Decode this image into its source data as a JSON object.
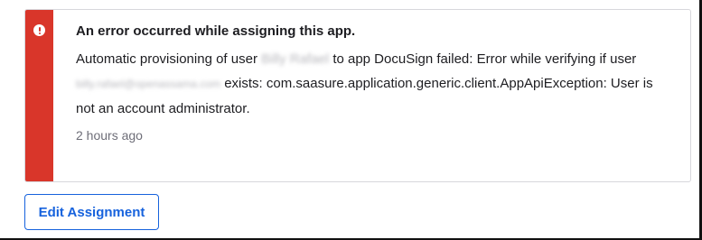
{
  "alert": {
    "severity": "error",
    "colors": {
      "accent_bar": "#d9362a",
      "border": "#d7d7dc",
      "text": "#1d1d21",
      "muted_text": "#6e6e78"
    },
    "icon": "error-circle-icon",
    "title": "An error occurred while assigning this app.",
    "message": {
      "part1": "Automatic provisioning of user",
      "user_name_redacted": "Billy Rafael",
      "part2": "to app DocuSign failed: Error while verifying if user",
      "user_email_redacted": "billy.rafael@openassama.com",
      "part3": "exists: com.saasure.application.generic.client.AppApiException: User is not an account administrator."
    },
    "timestamp": "2 hours ago"
  },
  "actions": {
    "edit_assignment_label": "Edit Assignment",
    "button_color": "#1662dd"
  }
}
